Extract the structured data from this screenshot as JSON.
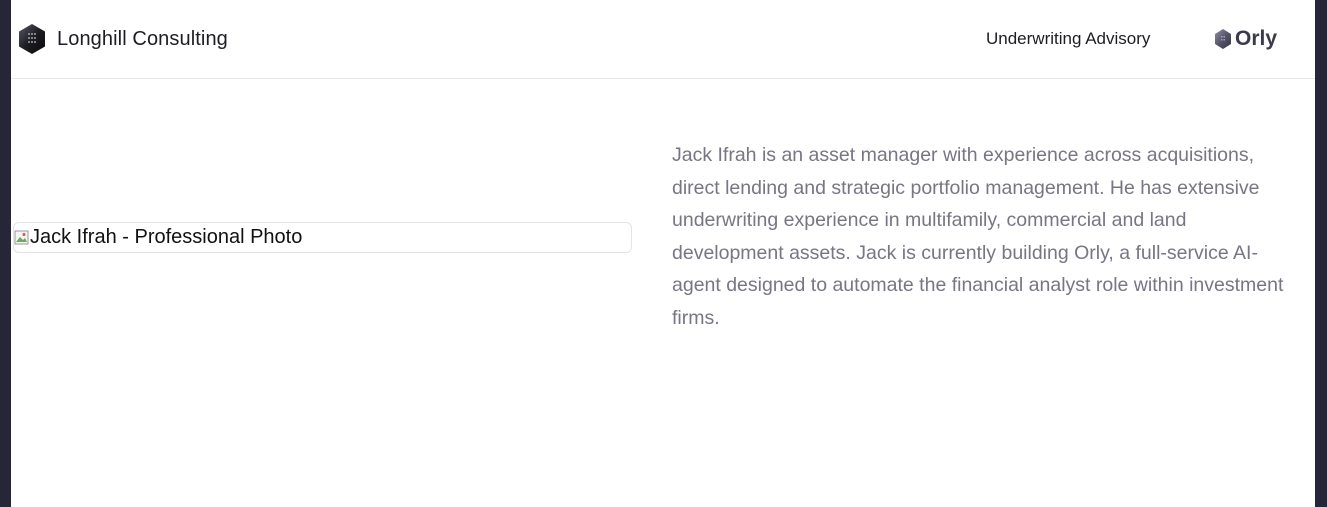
{
  "header": {
    "brand_name": "Longhill Consulting",
    "brand_logo_icon": "hexagon-logo-icon",
    "nav_link_label": "Underwriting Advisory",
    "orly_label": "Orly",
    "orly_logo_icon": "hexagon-logo-icon"
  },
  "main": {
    "photo_alt": "Jack Ifrah - Professional Photo",
    "photo_icon": "broken-image-icon",
    "bio": "Jack Ifrah is an asset manager with experience across acquisitions, direct lending and strategic portfolio management. He has extensive underwriting experience in multifamily, commercial and land development assets. Jack is currently building Orly, a full-service AI-agent designed to automate the financial analyst role within investment firms."
  },
  "colors": {
    "page_background": "#262638",
    "content_background": "#ffffff",
    "text_dark": "#1d1d24",
    "text_muted": "#767684",
    "border": "#e4e4e8"
  }
}
